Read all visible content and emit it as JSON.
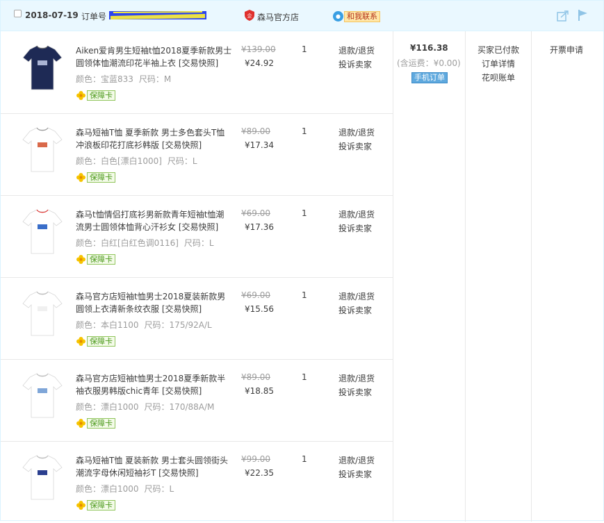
{
  "header": {
    "date": "2018-07-19",
    "order_no_label": "订单号",
    "shop_name": "森马官方店",
    "chat_label": "和我联系"
  },
  "items": [
    {
      "title": "Aiken爱肯男生短袖t恤2018夏季新款男士圆领体恤潮流印花半袖上衣 [交易快照]",
      "color": "颜色：宝蓝833",
      "size": "尺码：M",
      "guarantee": "保障卡",
      "orig_price": "¥139.00",
      "price": "¥24.92",
      "qty": "1",
      "refund": "退款/退货",
      "complain": "投诉卖家"
    },
    {
      "title": "森马短袖T恤 夏季新款 男士多色套头T恤冲浪板印花打底衫韩版 [交易快照]",
      "color": "颜色：白色[漂白1000]",
      "size": "尺码：L",
      "guarantee": "保障卡",
      "orig_price": "¥89.00",
      "price": "¥17.34",
      "qty": "1",
      "refund": "退款/退货",
      "complain": "投诉卖家"
    },
    {
      "title": "森马t恤情侣打底衫男新款青年短袖t恤潮流男士圆领体恤背心汗衫女 [交易快照]",
      "color": "颜色：白红[白红色调0116]",
      "size": "尺码：L",
      "guarantee": "保障卡",
      "orig_price": "¥69.00",
      "price": "¥17.36",
      "qty": "1",
      "refund": "退款/退货",
      "complain": "投诉卖家"
    },
    {
      "title": "森马官方店短袖t恤男士2018夏装新款男圆领上衣清新条纹衣服 [交易快照]",
      "color": "颜色：本白1100",
      "size": "尺码：175/92A/L",
      "guarantee": "保障卡",
      "orig_price": "¥69.00",
      "price": "¥15.56",
      "qty": "1",
      "refund": "退款/退货",
      "complain": "投诉卖家"
    },
    {
      "title": "森马官方店短袖t恤男士2018夏季新款半袖衣服男韩版chic青年 [交易快照]",
      "color": "颜色：漂白1000",
      "size": "尺码：170/88A/M",
      "guarantee": "保障卡",
      "orig_price": "¥89.00",
      "price": "¥18.85",
      "qty": "1",
      "refund": "退款/退货",
      "complain": "投诉卖家"
    },
    {
      "title": "森马短袖T恤 夏装新款 男士套头圆领街头潮流字母休闲短袖衫T [交易快照]",
      "color": "颜色：漂白1000",
      "size": "尺码：L",
      "guarantee": "保障卡",
      "orig_price": "¥99.00",
      "price": "¥22.35",
      "qty": "1",
      "refund": "退款/退货",
      "complain": "投诉卖家"
    }
  ],
  "summary": {
    "total": "¥116.38",
    "shipping": "(含运费：¥0.00)",
    "mobile_badge": "手机订单"
  },
  "status": {
    "paid": "买家已付款",
    "detail": "订单详情",
    "bill": "花呗账单"
  },
  "invoice": "开票申请",
  "icons": {
    "checkbox": "checkbox-icon",
    "shop": "shop-shield-icon",
    "chat": "chat-bubble-icon",
    "share": "share-icon",
    "flag": "flag-icon",
    "guarantee": "flower-icon"
  },
  "colors": {
    "header_bg": "#eaf8ff",
    "border": "#daf3ff",
    "badge_blue": "#5fa9de",
    "guarantee_green": "#4c9a1c"
  }
}
